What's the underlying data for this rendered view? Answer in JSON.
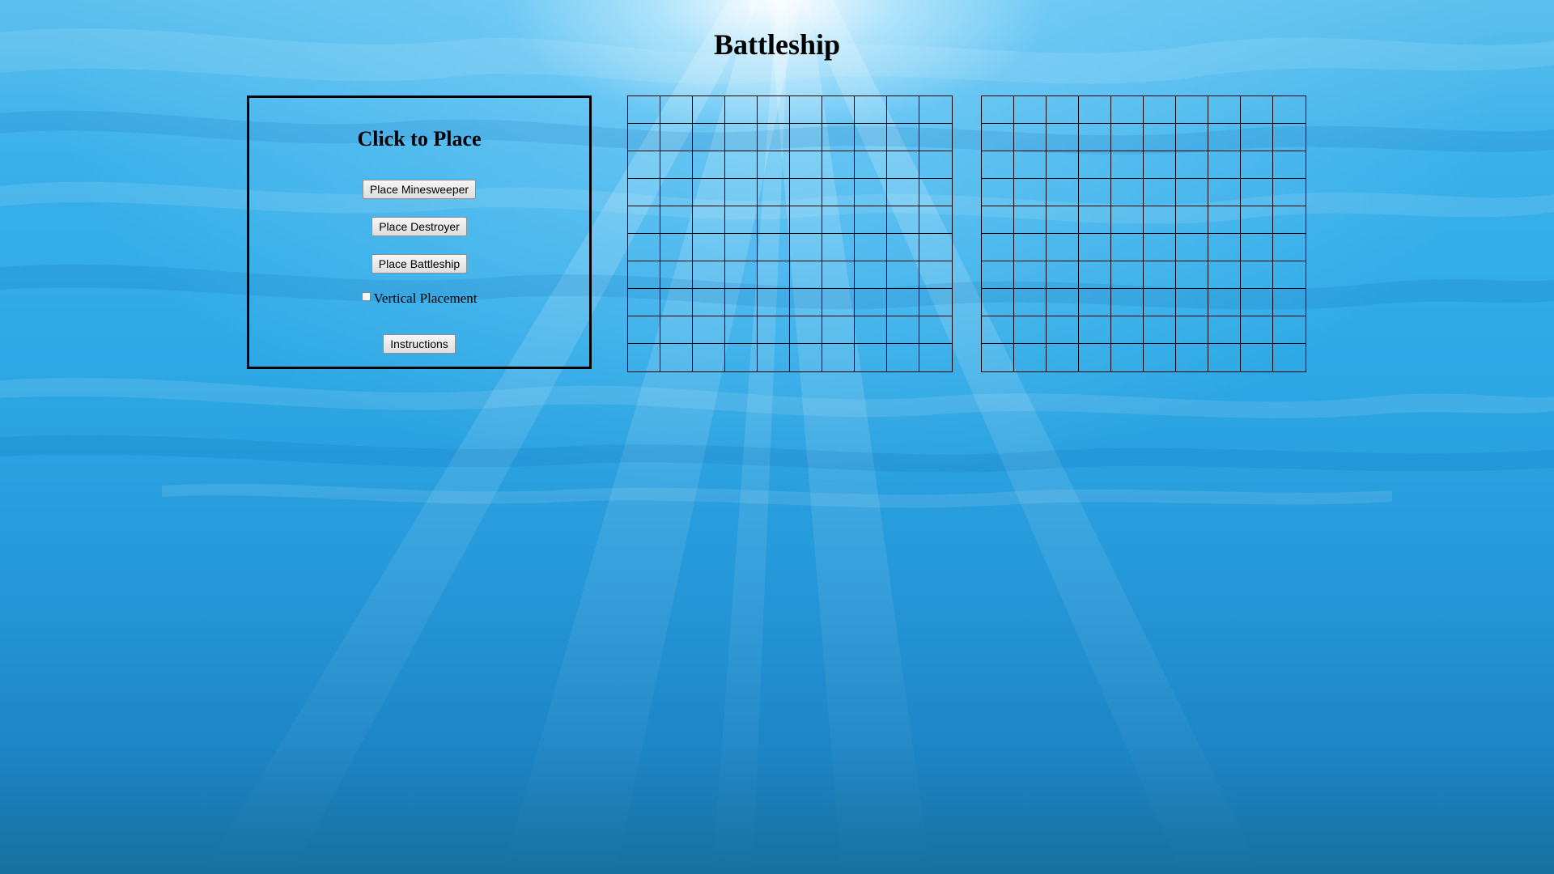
{
  "page": {
    "title": "Battleship"
  },
  "placement_panel": {
    "heading": "Click to Place",
    "buttons": {
      "minesweeper": "Place Minesweeper",
      "destroyer": "Place Destroyer",
      "battleship": "Place Battleship",
      "instructions": "Instructions"
    },
    "vertical_checkbox": {
      "label": "Vertical Placement",
      "checked": false
    }
  },
  "boards": {
    "rows": 10,
    "columns": 10,
    "player_board": "player-grid",
    "enemy_board": "enemy-grid"
  },
  "colors": {
    "water_light": "#5cc0ee",
    "water_deep": "#17709f",
    "grid_line": "#000000"
  }
}
